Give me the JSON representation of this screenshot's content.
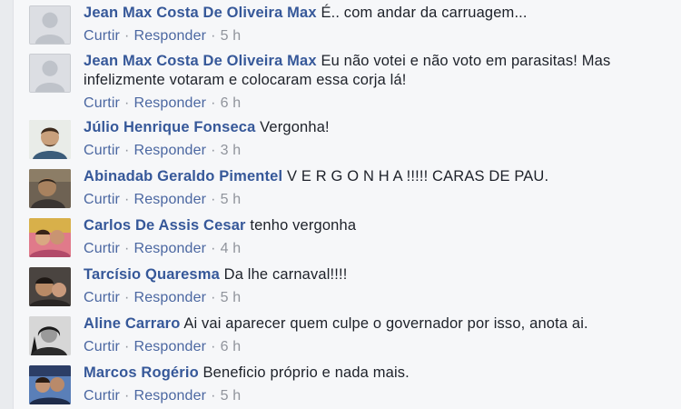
{
  "actions": {
    "like": "Curtir",
    "reply": "Responder",
    "separator": "·"
  },
  "comments": [
    {
      "author": "Jean Max Costa De Oliveira Max",
      "text": "É.. com andar da carruagem...",
      "time": "5 h",
      "avatar": "default-avatar"
    },
    {
      "author": "Jean Max Costa De Oliveira Max",
      "text": "Eu não votei e não voto em parasitas! Mas infelizmente votaram e colocaram essa corja lá!",
      "time": "6 h",
      "avatar": "default-avatar"
    },
    {
      "author": "Júlio Henrique Fonseca",
      "text": "Vergonha!",
      "time": "3 h",
      "avatar": "photo"
    },
    {
      "author": "Abinadab Geraldo Pimentel",
      "text": "V E R G O N H A !!!!! CARAS DE PAU.",
      "time": "5 h",
      "avatar": "photo"
    },
    {
      "author": "Carlos De Assis Cesar",
      "text": "tenho vergonha",
      "time": "4 h",
      "avatar": "photo"
    },
    {
      "author": "Tarcísio Quaresma",
      "text": "Da lhe carnaval!!!!",
      "time": "5 h",
      "avatar": "photo"
    },
    {
      "author": "Aline Carraro",
      "text": "Ai vai aparecer quem culpe o governador por isso, anota ai.",
      "time": "6 h",
      "avatar": "photo"
    },
    {
      "author": "Marcos Rogério",
      "text": "Beneficio próprio e nada mais.",
      "time": "5 h",
      "avatar": "photo"
    }
  ]
}
